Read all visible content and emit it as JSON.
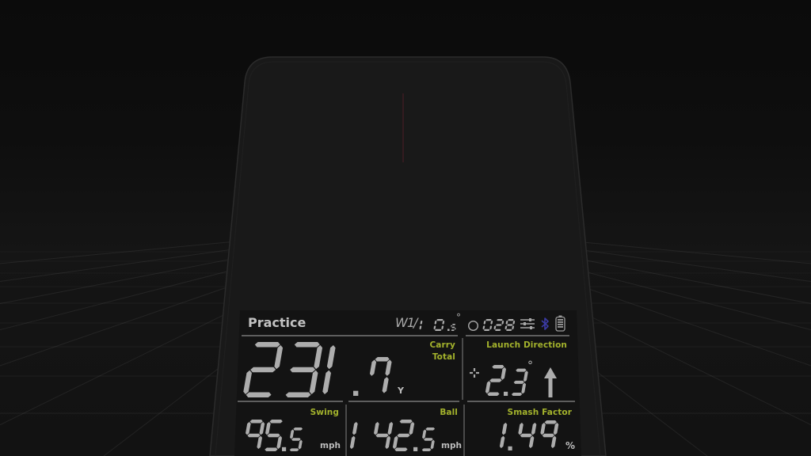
{
  "header": {
    "mode": "Practice",
    "club": "W1",
    "separator": "/",
    "loft": "10.5",
    "loft_unit": "°",
    "ball_count": "028",
    "icons": [
      "ball-icon",
      "sliders-icon",
      "bluetooth-icon",
      "battery-icon"
    ]
  },
  "distance": {
    "whole": "231",
    "decimal": ".7",
    "unit": "Y",
    "carry_label": "Carry",
    "total_label": "Total"
  },
  "launch_direction": {
    "label": "Launch Direction",
    "value": "2.3",
    "unit": "°",
    "target_icon": "crosshair-icon",
    "direction_icon": "arrow-up-icon"
  },
  "swing_speed": {
    "label": "Swing",
    "value": "95.5",
    "unit": "mph"
  },
  "ball_speed": {
    "label": "Ball",
    "value": "142.5",
    "unit": "mph"
  },
  "smash_factor": {
    "label": "Smash Factor",
    "value": "1.49",
    "unit": "%"
  },
  "colors": {
    "label": "#a3b22c",
    "segment": "#adadad",
    "bluetooth": "#3b3ba6",
    "aim_line": "#3e1c23"
  }
}
